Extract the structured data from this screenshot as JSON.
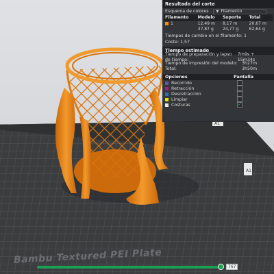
{
  "panel": {
    "title": "Resultado del corte",
    "scheme_label": "Esquema de colores",
    "scheme_value": "Filamento",
    "columns": [
      "Filamento",
      "Modelo",
      "Soporte",
      "Total"
    ],
    "rows": [
      {
        "id": "1",
        "modelo": "12,49 m",
        "soporte": "8,17 m",
        "total": "20,67 m"
      },
      {
        "id": "",
        "modelo": "37,87 g",
        "soporte": "24,77 g",
        "total": "62,64 g"
      }
    ],
    "change_time_label": "Tiempos de cambio en el filamento:",
    "change_time_value": "1",
    "cost_label": "Coste:",
    "cost_value": "1,57",
    "estimated_title": "Tiempo estimado",
    "prep_label": "Tiempo de preparación y lapso de tiempo:",
    "prep_value": "7m9s + 15m34s",
    "model_time_label": "Tiempo de impresión del modelo:",
    "model_time_value": "3h27m",
    "total_label": "Total:",
    "total_value": "3h50m",
    "options_header": "Opciones",
    "display_header": "Pantalla",
    "options": [
      {
        "label": "Recorrido",
        "color": "#5a5a9c",
        "checked": false
      },
      {
        "label": "Retracción",
        "color": "#a0208c",
        "checked": false
      },
      {
        "label": "Desretracción",
        "color": "#2a6fb0",
        "checked": false
      },
      {
        "label": "Limpiar",
        "color": "#e6e600",
        "checked": false
      },
      {
        "label": "Costuras",
        "color": "#e8e8e8",
        "checked": true
      }
    ],
    "filament_color": "#ff8b00"
  },
  "plate": {
    "name": "Bambu Textured PEI Plate",
    "badge_top": "A1",
    "badge_right": "A1"
  },
  "layer_slider": {
    "value": "767",
    "fill": 0.96
  },
  "colors": {
    "model": "#e07c10",
    "plate_bg": "#3b3d3f",
    "grid": "#5b5d5f",
    "accent": "#1aa153"
  }
}
